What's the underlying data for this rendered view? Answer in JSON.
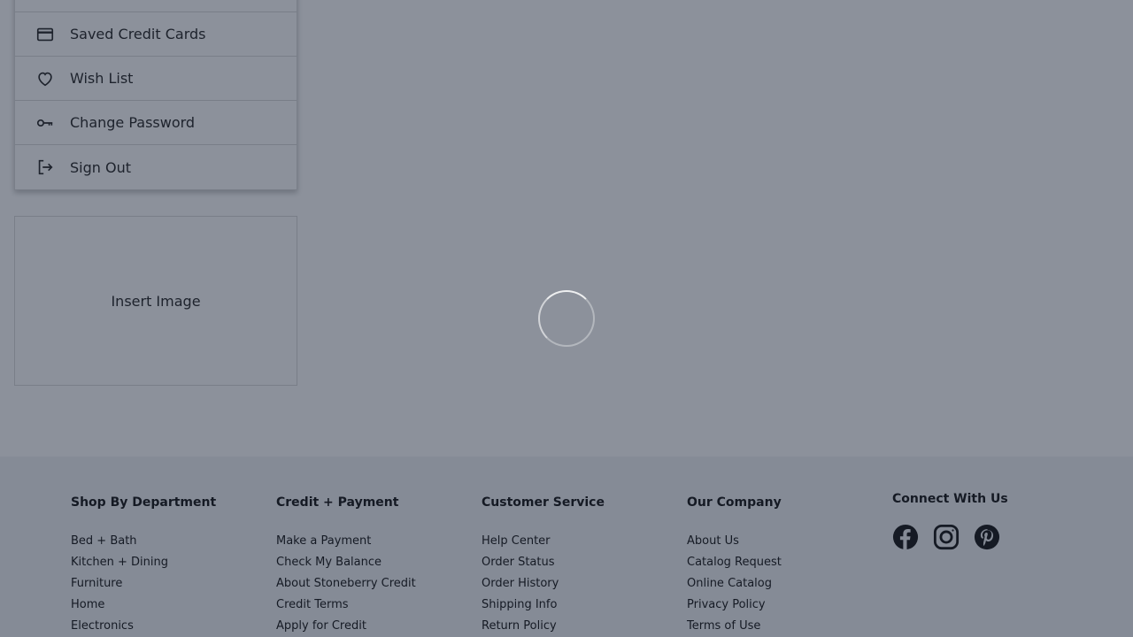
{
  "sidebar": {
    "items": [
      {
        "label": "",
        "icon": "blank"
      },
      {
        "label": "Saved Credit Cards",
        "icon": "credit-card-icon"
      },
      {
        "label": "Wish List",
        "icon": "heart-icon"
      },
      {
        "label": "Change Password",
        "icon": "key-icon"
      },
      {
        "label": "Sign Out",
        "icon": "sign-out-icon"
      }
    ]
  },
  "image_placeholder": {
    "label": "Insert Image"
  },
  "footer": {
    "columns": [
      {
        "heading": "Shop By Department",
        "links": [
          "Bed + Bath",
          "Kitchen + Dining",
          "Furniture",
          "Home",
          "Electronics"
        ]
      },
      {
        "heading": "Credit + Payment",
        "links": [
          "Make a Payment",
          "Check My Balance",
          "About Stoneberry Credit",
          "Credit Terms",
          "Apply for Credit"
        ]
      },
      {
        "heading": "Customer Service",
        "links": [
          "Help Center",
          "Order Status",
          "Order History",
          "Shipping Info",
          "Return Policy"
        ]
      },
      {
        "heading": "Our Company",
        "links": [
          "About Us",
          "Catalog Request",
          "Online Catalog",
          "Privacy Policy",
          "Terms of Use"
        ]
      }
    ],
    "social": {
      "heading": "Connect With Us",
      "icons": [
        "facebook-icon",
        "instagram-icon",
        "pinterest-icon"
      ]
    }
  },
  "colors": {
    "overlay": "#192337",
    "footer_bg": "#f1f3f5",
    "text": "#111111"
  }
}
